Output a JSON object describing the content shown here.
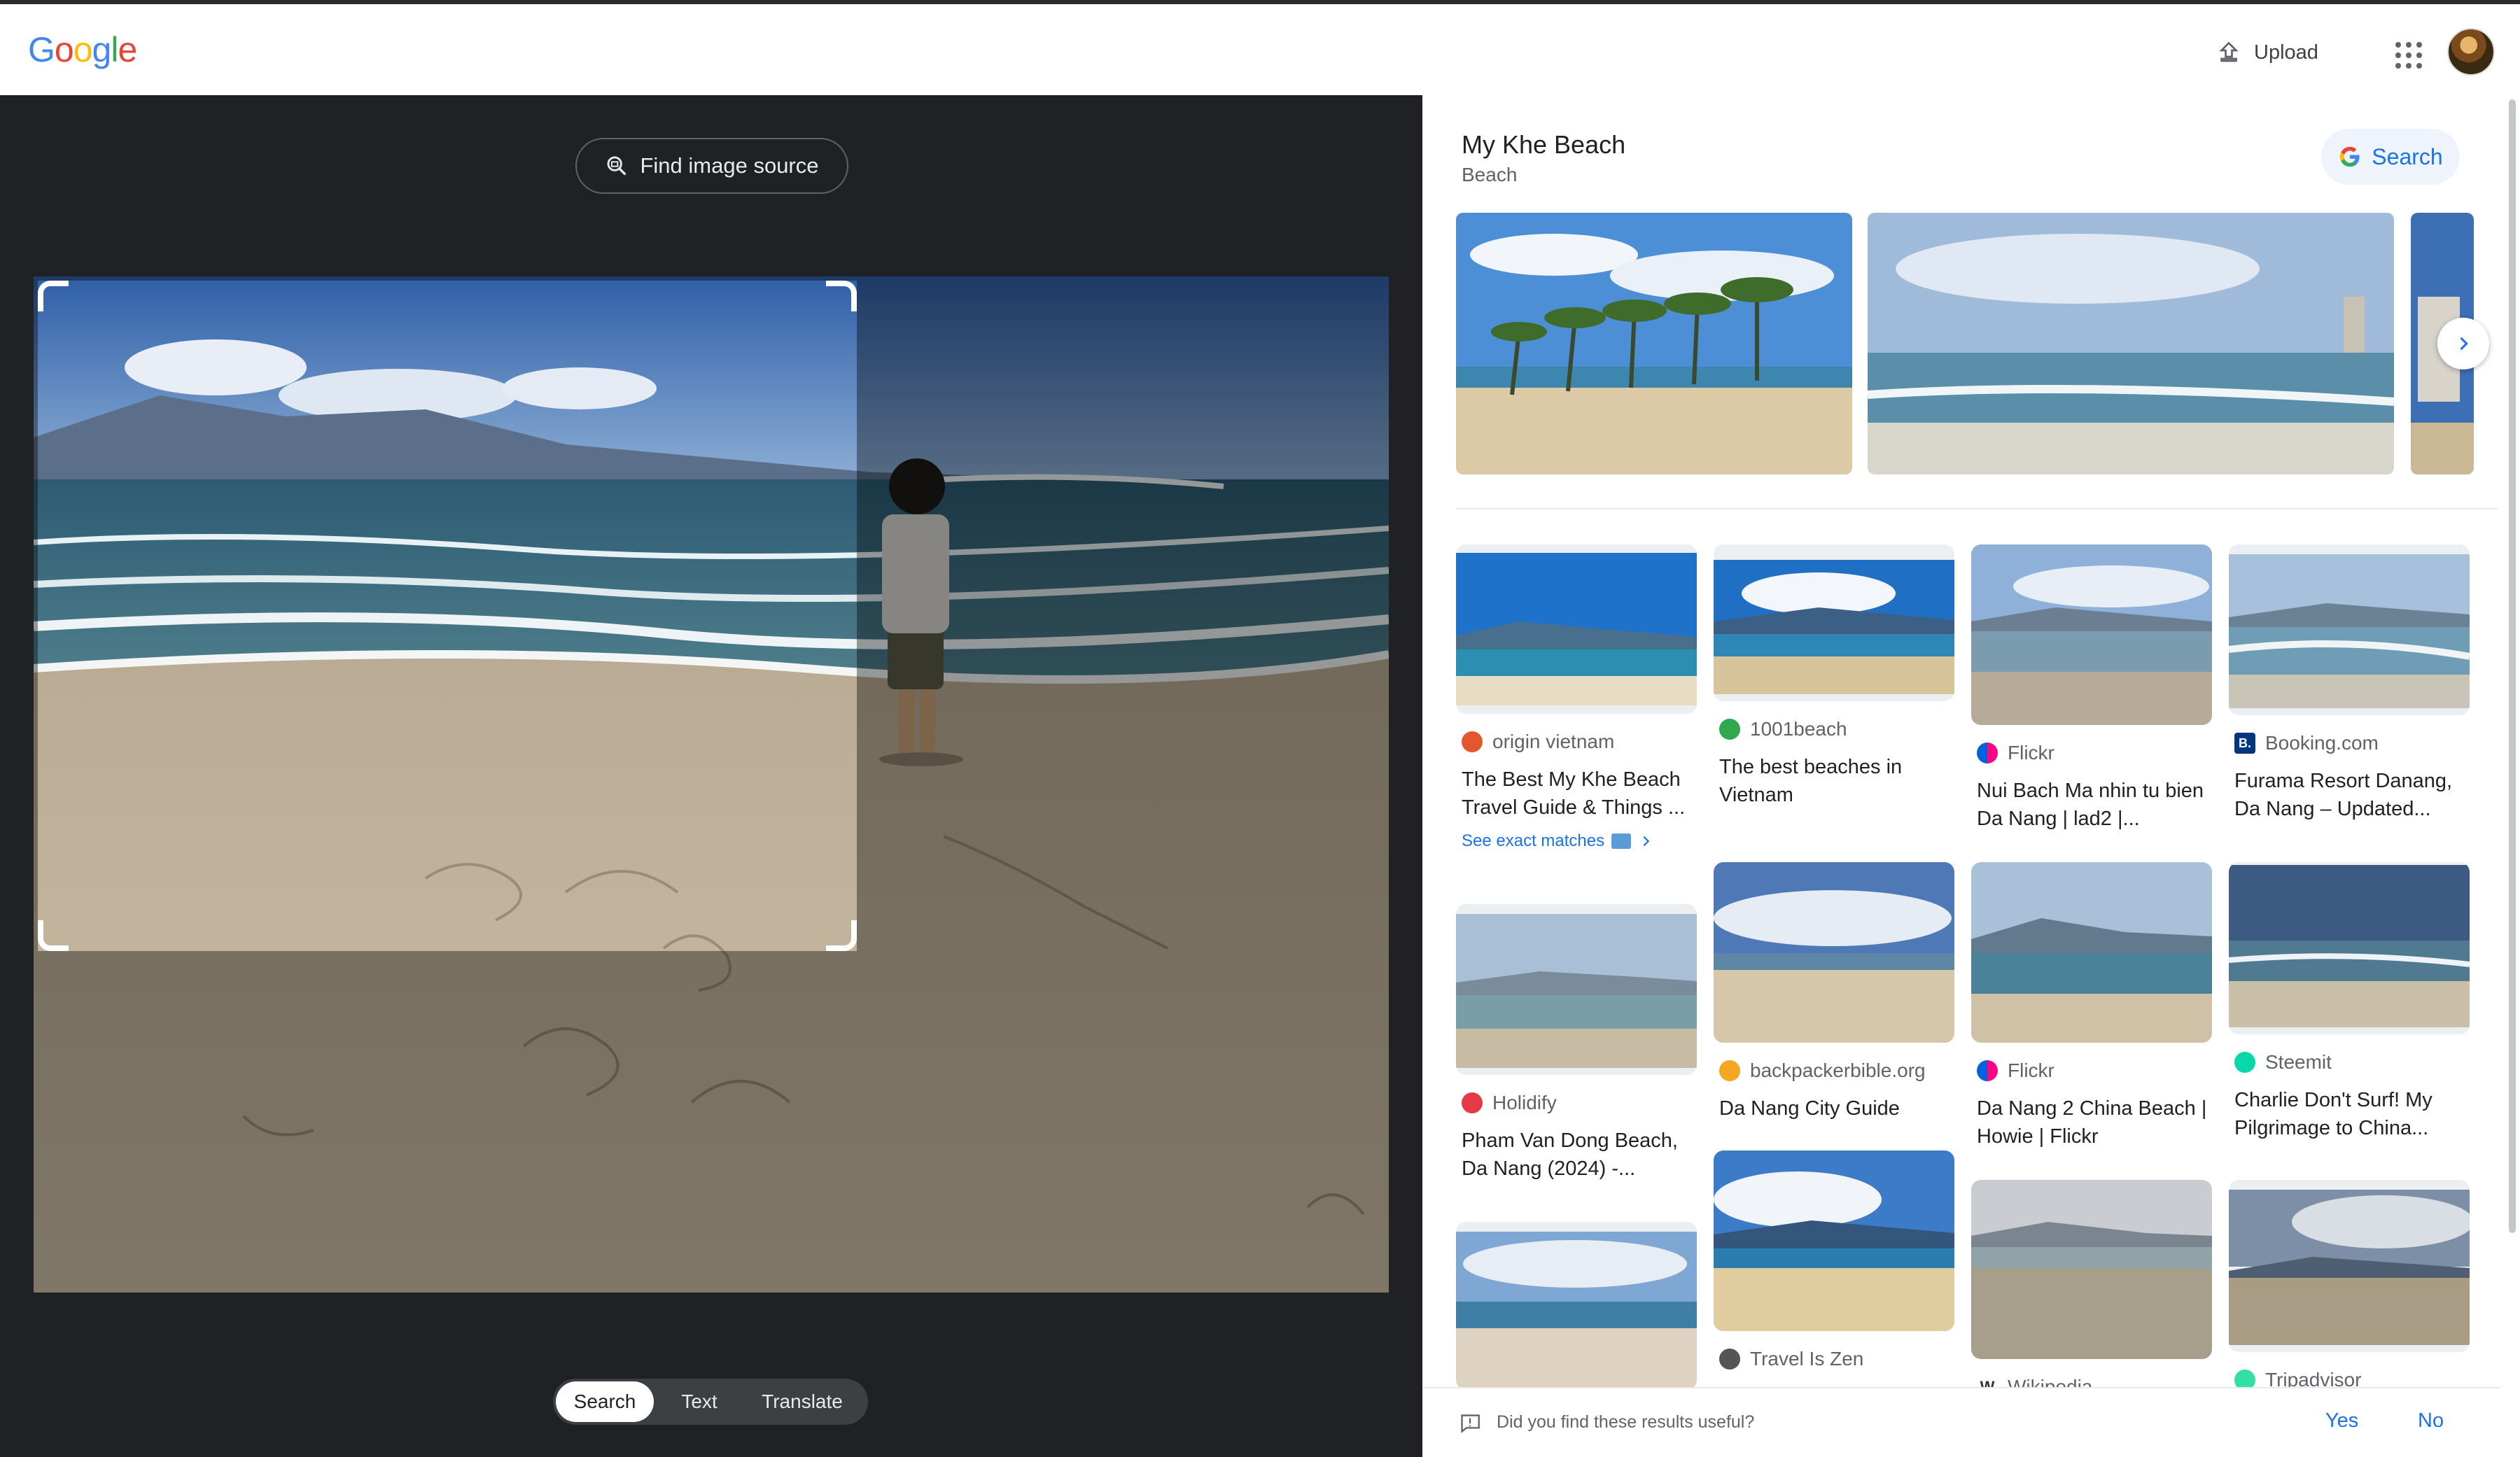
{
  "header": {
    "logo": [
      "G",
      "o",
      "o",
      "g",
      "l",
      "e"
    ],
    "logo_colors": [
      "#4285F4",
      "#EA4335",
      "#FBBC05",
      "#4285F4",
      "#34A853",
      "#EA4335"
    ],
    "upload_label": "Upload"
  },
  "viewer": {
    "find_source_label": "Find image source",
    "tabs": [
      "Search",
      "Text",
      "Translate"
    ],
    "active_tab": "Search"
  },
  "knowledge_panel": {
    "title": "My Khe Beach",
    "subtitle": "Beach",
    "search_label": "Search"
  },
  "results": [
    {
      "source": "origin vietnam",
      "title": "The Best My Khe Beach Travel Guide & Things ...",
      "exact": "See exact matches",
      "icon_color": "#e4572e"
    },
    {
      "source": "1001beach",
      "title": "The best beaches in Vietnam",
      "icon_color": "#2fa84f"
    },
    {
      "source": "Flickr",
      "title": "Nui Bach Ma nhin tu bien Da Nang | lad2 |...",
      "icon_color": "#ff0084"
    },
    {
      "source": "Booking.com",
      "title": "Furama Resort Danang, Da Nang – Updated...",
      "icon_color": "#003580",
      "icon_text": "B."
    },
    {
      "source": "Holidify",
      "title": "Pham Van Dong Beach, Da Nang (2024) -...",
      "icon_color": "#e63946"
    },
    {
      "source": "backpackerbible.org",
      "title": "Da Nang City Guide",
      "icon_color": "#f5a623"
    },
    {
      "source": "Flickr",
      "title": "Da Nang 2 China Beach | Howie | Flickr",
      "icon_color": "#ff0084"
    },
    {
      "source": "Steemit",
      "title": "Charlie Don't Surf! My Pilgrimage to China...",
      "icon_color": "#07d7a9"
    },
    {
      "source": "Travel Is Zen",
      "title": "",
      "icon_color": "#555555"
    },
    {
      "source": "Wikipedia",
      "title": "",
      "icon_color": "#333333",
      "icon_text": "W"
    },
    {
      "source": "Tripadvisor",
      "title": "",
      "icon_color": "#34e0a1"
    }
  ],
  "feedback": {
    "question": "Did you find these results useful?",
    "yes": "Yes",
    "no": "No"
  }
}
